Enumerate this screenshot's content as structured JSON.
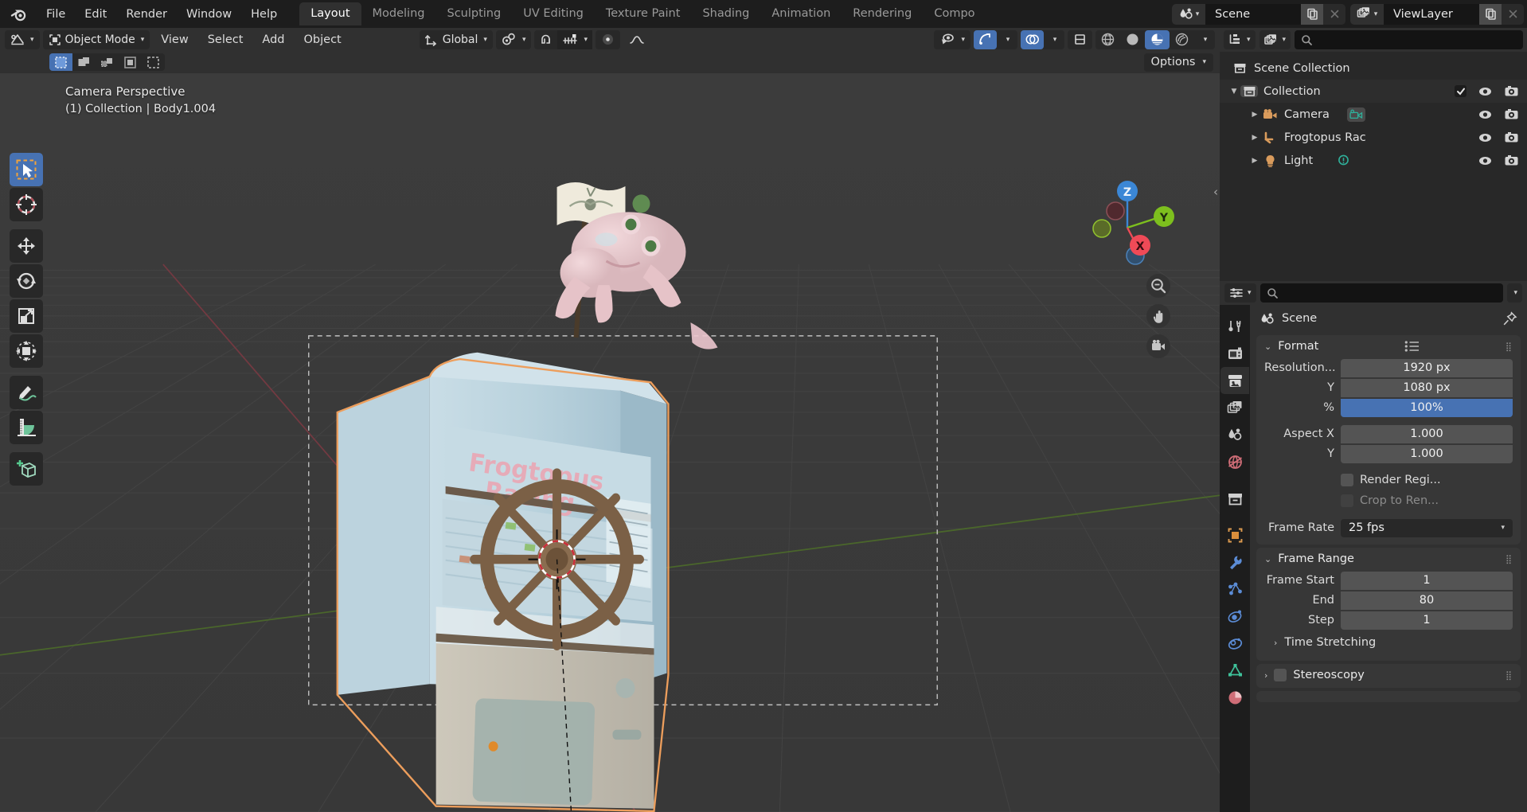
{
  "app": {
    "logo_icon": "blender-logo",
    "menus": [
      "File",
      "Edit",
      "Render",
      "Window",
      "Help"
    ],
    "workspace_tabs": [
      {
        "label": "Layout",
        "active": true
      },
      {
        "label": "Modeling",
        "active": false
      },
      {
        "label": "Sculpting",
        "active": false
      },
      {
        "label": "UV Editing",
        "active": false
      },
      {
        "label": "Texture Paint",
        "active": false
      },
      {
        "label": "Shading",
        "active": false
      },
      {
        "label": "Animation",
        "active": false
      },
      {
        "label": "Rendering",
        "active": false
      },
      {
        "label": "Compo",
        "active": false
      }
    ],
    "scene_block": {
      "icon": "scene-icon",
      "name": "Scene",
      "new_icon": "copy-icon",
      "unlink_icon": "x-icon"
    },
    "viewlayer_block": {
      "icon": "viewlayer-icon",
      "name": "ViewLayer",
      "new_icon": "copy-icon",
      "unlink_icon": "x-icon"
    }
  },
  "viewport": {
    "header": {
      "editor_type_icon": "editor-type-3dview-icon",
      "mode": "Object Mode",
      "mode_icon": "object-mode-icon",
      "menus": [
        "View",
        "Select",
        "Add",
        "Object"
      ],
      "transform_orientation": "Global",
      "transform_orientation_icon": "orientation-icon",
      "snap_icon": "magnet-icon",
      "pivot_icon": "pivot-icon",
      "proportional_icon": "proportional-edit-icon",
      "snap_increment_icon": "snap-increment-icon",
      "visibility_icon": "eye-icon",
      "gizmo_icon": "gizmo-icon",
      "overlays_icon": "overlays-icon",
      "xray_icon": "xray-icon",
      "shading_modes": [
        {
          "name": "wireframe-shading",
          "active": false
        },
        {
          "name": "solid-shading",
          "active": false
        },
        {
          "name": "material-preview-shading",
          "active": true
        },
        {
          "name": "rendered-shading",
          "active": false
        }
      ]
    },
    "header2": {
      "select_modes": [
        {
          "name": "tweak-select",
          "active": true
        },
        {
          "name": "box-select",
          "active": false
        },
        {
          "name": "circle-select",
          "active": false
        },
        {
          "name": "lasso-select",
          "active": false
        },
        {
          "name": "select-extend",
          "active": false
        }
      ],
      "options_label": "Options",
      "options_chevron": "chevron-down-icon"
    },
    "overlay_line1": "Camera Perspective",
    "overlay_line2": "(1) Collection | Body1.004",
    "gizmo": {
      "axes": [
        {
          "label": "Z",
          "color": "#3b87d6"
        },
        {
          "label": "Y",
          "color": "#7dbf1e"
        },
        {
          "label": "X",
          "color": "#ef4a57"
        }
      ]
    },
    "nav_buttons": [
      "zoom-icon",
      "pan-icon",
      "camera-view-icon"
    ],
    "tools": [
      {
        "name": "tweak-tool",
        "active": true
      },
      {
        "name": "cursor-tool",
        "active": false
      },
      {
        "name": "move-tool",
        "active": false
      },
      {
        "name": "rotate-tool",
        "active": false
      },
      {
        "name": "scale-tool",
        "active": false
      },
      {
        "name": "transform-tool",
        "active": false
      },
      {
        "name": "annotate-tool",
        "active": false
      },
      {
        "name": "measure-tool",
        "active": false
      },
      {
        "name": "add-cube-tool",
        "active": false
      }
    ],
    "scene_objects": {
      "arcade_machine_text_line1": "Frogtopus",
      "arcade_machine_text_line2": "Racing"
    }
  },
  "outliner": {
    "display_mode_icon": "outliner-display-mode-icon",
    "filter_icon": "outliner-filter-icon",
    "search_placeholder": "",
    "search_icon": "search-icon",
    "rows": [
      {
        "label": "Scene Collection",
        "icon": "collection-icon",
        "indent": 0,
        "expander": "",
        "checkbox": false,
        "eye": false,
        "camera": false,
        "extra_icon": ""
      },
      {
        "label": "Collection",
        "icon": "collection-icon",
        "indent": 1,
        "expander": "down",
        "checkbox": true,
        "eye": true,
        "camera": true,
        "extra_icon": ""
      },
      {
        "label": "Camera",
        "icon": "camera-object-icon",
        "indent": 2,
        "expander": "right",
        "checkbox": false,
        "eye": true,
        "camera": true,
        "extra_icon": "camera-data-icon"
      },
      {
        "label": "Frogtopus Rac",
        "icon": "empty-object-icon",
        "indent": 2,
        "expander": "right",
        "checkbox": false,
        "eye": true,
        "camera": true,
        "extra_icon": ""
      },
      {
        "label": "Light",
        "icon": "light-object-icon",
        "indent": 2,
        "expander": "right",
        "checkbox": false,
        "eye": true,
        "camera": true,
        "extra_icon": "light-data-icon"
      }
    ]
  },
  "properties": {
    "editor_icon": "editor-type-properties-icon",
    "search_placeholder": "",
    "search_icon": "search-icon",
    "options_chevron": "chevron-down-icon",
    "tabs": [
      {
        "name": "tool-tab",
        "active": false,
        "color": "#d0d0d0"
      },
      {
        "name": "render-tab",
        "active": false,
        "color": "#d0d0d0"
      },
      {
        "name": "output-tab",
        "active": true,
        "color": "#d0d0d0"
      },
      {
        "name": "view-layer-tab",
        "active": false,
        "color": "#d0d0d0"
      },
      {
        "name": "scene-tab",
        "active": false,
        "color": "#d0d0d0"
      },
      {
        "name": "world-tab",
        "active": false,
        "color": "#d36a72"
      },
      {
        "name": "collection-tab",
        "active": false,
        "color": "#d0d0d0"
      },
      {
        "name": "object-tab",
        "active": false,
        "color": "#e0a060"
      },
      {
        "name": "modifiers-tab",
        "active": false,
        "color": "#5b8cd6"
      },
      {
        "name": "particles-tab",
        "active": false,
        "color": "#5b8cd6"
      },
      {
        "name": "physics-tab",
        "active": false,
        "color": "#5b8cd6"
      },
      {
        "name": "constraints-tab",
        "active": false,
        "color": "#5b8cd6"
      },
      {
        "name": "data-tab",
        "active": false,
        "color": "#3ec29a"
      },
      {
        "name": "material-tab",
        "active": false,
        "color": "#d36a72"
      }
    ],
    "breadcrumb": {
      "icon": "scene-icon",
      "label": "Scene",
      "pin_icon": "pin-icon"
    },
    "panels": [
      {
        "title": "Format",
        "expanded": true,
        "has_list_icon": true,
        "fields": [
          {
            "type": "value",
            "label": "Resolution...",
            "value": "1920 px",
            "style": "top"
          },
          {
            "type": "value",
            "label": "Y",
            "value": "1080 px",
            "style": "mid"
          },
          {
            "type": "value",
            "label": "%",
            "value": "100%",
            "style": "bot",
            "highlight": true
          },
          {
            "type": "value",
            "label": "Aspect X",
            "value": "1.000",
            "style": "top"
          },
          {
            "type": "value",
            "label": "Y",
            "value": "1.000",
            "style": "bot"
          },
          {
            "type": "checkbox",
            "label": "Render Regi...",
            "checked": false,
            "dim": false
          },
          {
            "type": "checkbox",
            "label": "Crop to Ren...",
            "checked": false,
            "dim": true
          },
          {
            "type": "dropdown",
            "label": "Frame Rate",
            "value": "25 fps"
          }
        ]
      },
      {
        "title": "Frame Range",
        "expanded": true,
        "has_list_icon": false,
        "fields": [
          {
            "type": "value",
            "label": "Frame Start",
            "value": "1",
            "style": "top"
          },
          {
            "type": "value",
            "label": "End",
            "value": "80",
            "style": "mid"
          },
          {
            "type": "value",
            "label": "Step",
            "value": "1",
            "style": "bot"
          }
        ],
        "subpanels": [
          {
            "title": "Time Stretching",
            "expanded": false,
            "checkbox": false
          }
        ]
      },
      {
        "title": "Stereoscopy",
        "expanded": false,
        "has_checkbox": true,
        "fields": []
      }
    ]
  },
  "colors": {
    "accent_blue": "#4772b3",
    "panel_bg": "#373737",
    "editor_bg": "#303030",
    "window_bg": "#1d1d1d",
    "field_bg": "#545454",
    "selection_orange": "#ed9e5c"
  }
}
